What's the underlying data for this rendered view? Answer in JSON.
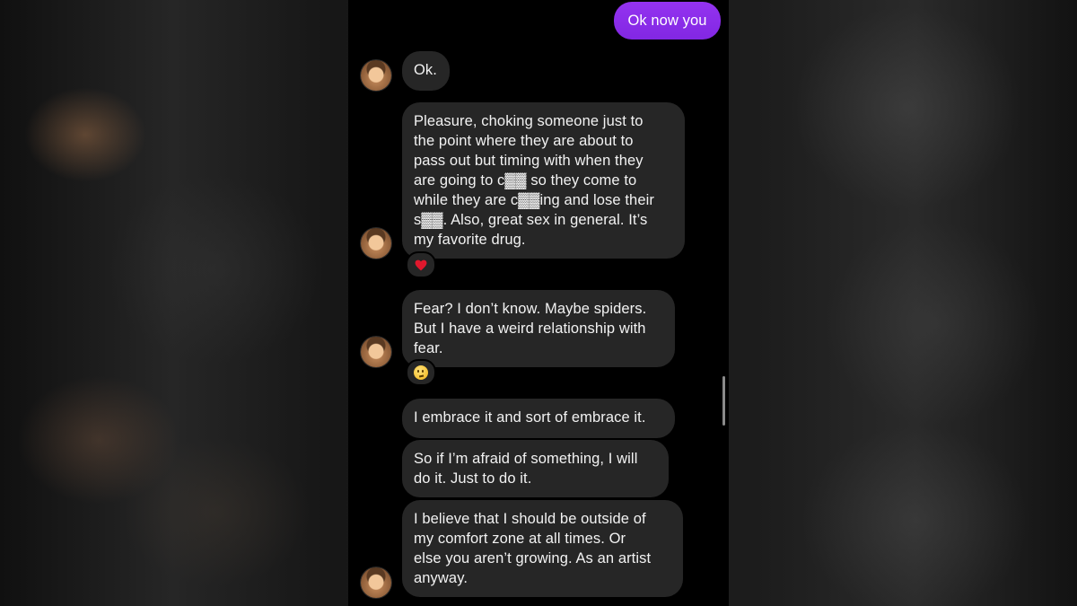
{
  "outgoing": {
    "text": "Ok now you"
  },
  "messages": [
    {
      "text": "Ok."
    },
    {
      "text": "Pleasure, choking someone just to\nthe point where they are about to\npass out but timing with when they\nare going to c▓▓ so they come to\nwhile they are c▓▓ing and lose their\ns▓▓. Also, great sex in general. It’s\nmy favorite drug.",
      "reaction": "heart-icon"
    },
    {
      "text": "Fear? I don’t know. Maybe spiders.\nBut I have a weird relationship with\nfear.",
      "reaction": "thinking-face-icon"
    },
    {
      "text": "I embrace it and sort of embrace it."
    },
    {
      "text": "So if I’m afraid of something, I will\ndo it. Just to do it."
    },
    {
      "text": "I believe that I should be outside of\nmy comfort zone at all times. Or\nelse you aren’t growing. As an artist\nanyway."
    }
  ],
  "colors": {
    "outgoing_bubble": "#8a2be2",
    "incoming_bubble": "#262626",
    "background": "#000000"
  }
}
